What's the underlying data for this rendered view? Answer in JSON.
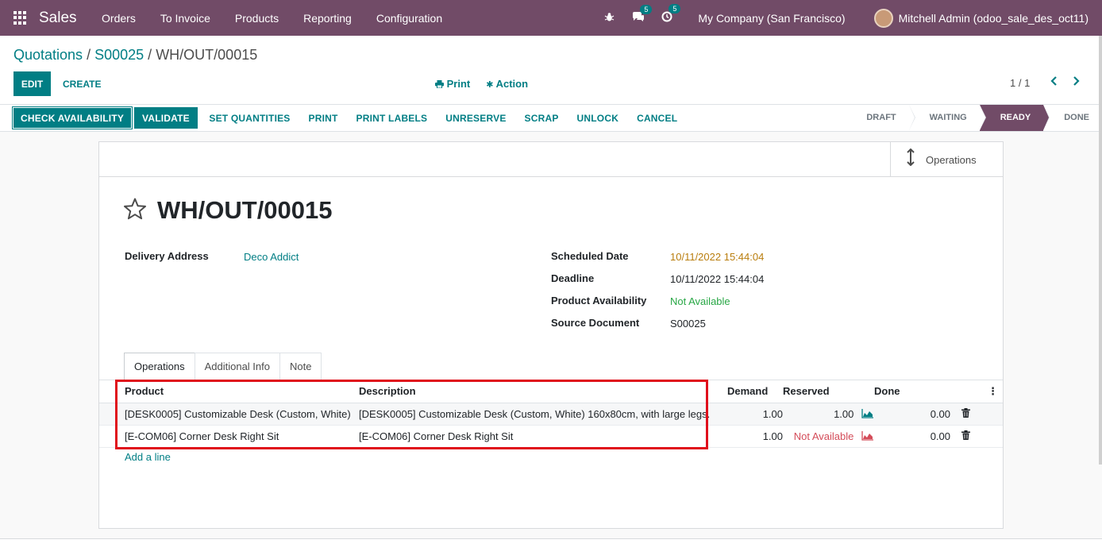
{
  "navbar": {
    "brand": "Sales",
    "menu": [
      "Orders",
      "To Invoice",
      "Products",
      "Reporting",
      "Configuration"
    ],
    "messages_badge": "5",
    "activities_badge": "5",
    "company": "My Company (San Francisco)",
    "user": "Mitchell Admin (odoo_sale_des_oct11)",
    "icons": [
      "apps-grid-icon",
      "bug-icon",
      "chat-icon",
      "clock-icon",
      "avatar"
    ]
  },
  "control_panel": {
    "breadcrumb": [
      "Quotations",
      "S00025",
      "WH/OUT/00015"
    ],
    "edit_label": "EDIT",
    "create_label": "CREATE",
    "print_label": "Print",
    "action_label": "Action",
    "pager": "1 / 1"
  },
  "statusbar": {
    "buttons": [
      "CHECK AVAILABILITY",
      "VALIDATE",
      "SET QUANTITIES",
      "PRINT",
      "PRINT LABELS",
      "UNRESERVE",
      "SCRAP",
      "UNLOCK",
      "CANCEL"
    ],
    "steps": [
      "DRAFT",
      "WAITING",
      "READY",
      "DONE"
    ],
    "active_step": "READY"
  },
  "sheet": {
    "smart_button": "Operations",
    "title": "WH/OUT/00015",
    "delivery_address_label": "Delivery Address",
    "delivery_address": "Deco Addict",
    "scheduled_date_label": "Scheduled Date",
    "scheduled_date": "10/11/2022 15:44:04",
    "deadline_label": "Deadline",
    "deadline": "10/11/2022 15:44:04",
    "availability_label": "Product Availability",
    "availability": "Not Available",
    "source_label": "Source Document",
    "source": "S00025"
  },
  "tabs": [
    "Operations",
    "Additional Info",
    "Note"
  ],
  "table": {
    "headers": {
      "product": "Product",
      "description": "Description",
      "demand": "Demand",
      "reserved": "Reserved",
      "done": "Done"
    },
    "rows": [
      {
        "product": "[DESK0005] Customizable Desk (Custom, White)",
        "description": "[DESK0005] Customizable Desk (Custom, White) 160x80cm, with large legs.",
        "demand": "1.00",
        "reserved": "1.00",
        "done": "0.00"
      },
      {
        "product": "[E-COM06] Corner Desk Right Sit",
        "description": "[E-COM06] Corner Desk Right Sit",
        "demand": "1.00",
        "reserved": "Not Available",
        "done": "0.00"
      }
    ],
    "add_line": "Add a line"
  },
  "colors": {
    "brand": "#714b67",
    "accent": "#017e84",
    "danger": "#d44c59",
    "highlight": "#e0101c"
  }
}
